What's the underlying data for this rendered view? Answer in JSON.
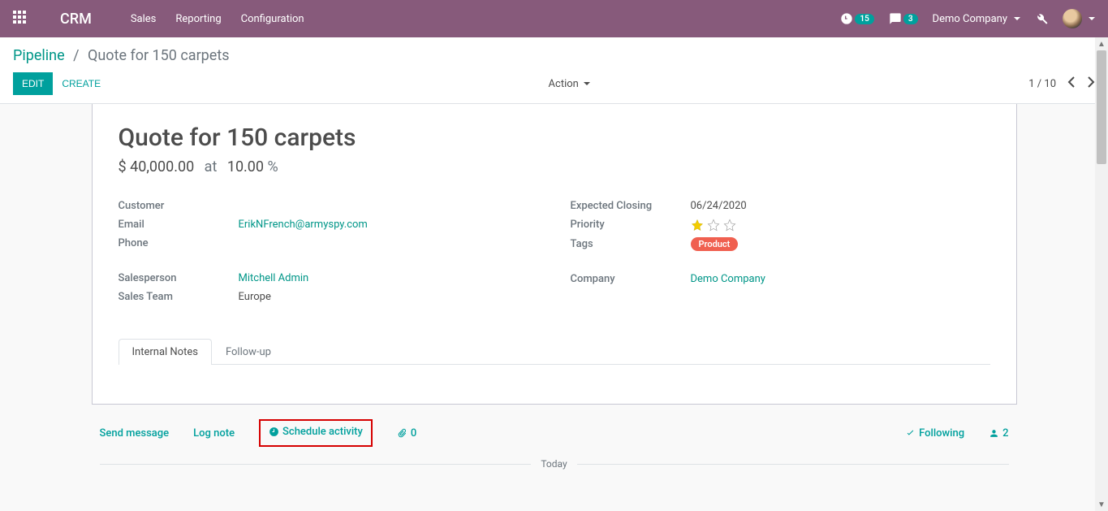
{
  "topnav": {
    "brand": "CRM",
    "items": [
      "Sales",
      "Reporting",
      "Configuration"
    ],
    "clock_badge": "15",
    "chat_badge": "3",
    "company": "Demo Company"
  },
  "breadcrumb": {
    "root": "Pipeline",
    "current": "Quote for 150 carpets"
  },
  "buttons": {
    "edit": "EDIT",
    "create": "CREATE",
    "action": "Action"
  },
  "pager": {
    "text": "1 / 10"
  },
  "record": {
    "title": "Quote for 150 carpets",
    "currency": "$",
    "amount": "40,000.00",
    "at": "at",
    "prob": "10.00",
    "pct": "%",
    "labels": {
      "customer": "Customer",
      "email": "Email",
      "phone": "Phone",
      "salesperson": "Salesperson",
      "sales_team": "Sales Team",
      "expected_closing": "Expected Closing",
      "priority": "Priority",
      "tags": "Tags",
      "company": "Company"
    },
    "values": {
      "customer": "",
      "email": "ErikNFrench@armyspy.com",
      "phone": "",
      "salesperson": "Mitchell Admin",
      "sales_team": "Europe",
      "expected_closing": "06/24/2020",
      "priority_stars": 1,
      "tag": "Product",
      "company": "Demo Company"
    }
  },
  "tabs": {
    "internal": "Internal Notes",
    "followup": "Follow-up"
  },
  "chatter": {
    "send": "Send message",
    "log": "Log note",
    "schedule": "Schedule activity",
    "attach": "0",
    "following": "Following",
    "followers": "2",
    "today": "Today"
  }
}
